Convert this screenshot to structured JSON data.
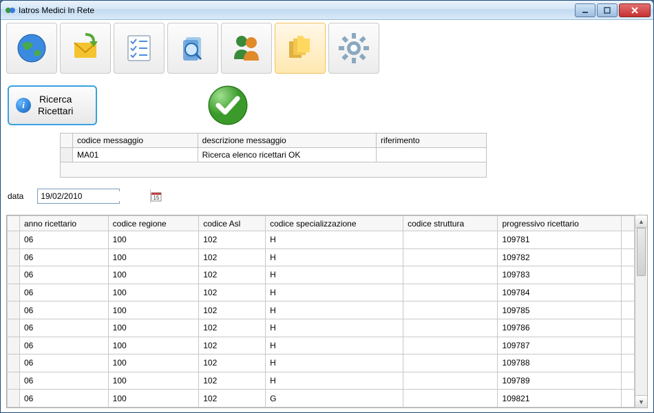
{
  "window": {
    "title": "Iatros Medici In Rete"
  },
  "toolbar": {
    "items": [
      {
        "name": "globe-icon"
      },
      {
        "name": "mail-icon"
      },
      {
        "name": "checklist-icon"
      },
      {
        "name": "search-glass-icon"
      },
      {
        "name": "people-icon"
      },
      {
        "name": "folders-icon",
        "active": true
      },
      {
        "name": "gear-icon"
      }
    ]
  },
  "ricerca": {
    "button_line1": "Ricerca",
    "button_line2": "Ricettari"
  },
  "message_table": {
    "headers": [
      "codice messaggio",
      "descrizione messaggio",
      "riferimento"
    ],
    "rows": [
      {
        "codice": "MA01",
        "descrizione": "Ricerca elenco ricettari OK",
        "riferimento": ""
      }
    ]
  },
  "data_field": {
    "label": "data",
    "value": "19/02/2010"
  },
  "results": {
    "headers": [
      "anno ricettario",
      "codice regione",
      "codice Asl",
      "codice specializzazione",
      "codice struttura",
      "progressivo ricettario"
    ],
    "rows": [
      {
        "anno": "06",
        "regione": "100",
        "asl": "102",
        "spec": "H",
        "strutt": "",
        "prog": "109781"
      },
      {
        "anno": "06",
        "regione": "100",
        "asl": "102",
        "spec": "H",
        "strutt": "",
        "prog": "109782"
      },
      {
        "anno": "06",
        "regione": "100",
        "asl": "102",
        "spec": "H",
        "strutt": "",
        "prog": "109783"
      },
      {
        "anno": "06",
        "regione": "100",
        "asl": "102",
        "spec": "H",
        "strutt": "",
        "prog": "109784"
      },
      {
        "anno": "06",
        "regione": "100",
        "asl": "102",
        "spec": "H",
        "strutt": "",
        "prog": "109785"
      },
      {
        "anno": "06",
        "regione": "100",
        "asl": "102",
        "spec": "H",
        "strutt": "",
        "prog": "109786"
      },
      {
        "anno": "06",
        "regione": "100",
        "asl": "102",
        "spec": "H",
        "strutt": "",
        "prog": "109787"
      },
      {
        "anno": "06",
        "regione": "100",
        "asl": "102",
        "spec": "H",
        "strutt": "",
        "prog": "109788"
      },
      {
        "anno": "06",
        "regione": "100",
        "asl": "102",
        "spec": "H",
        "strutt": "",
        "prog": "109789"
      },
      {
        "anno": "06",
        "regione": "100",
        "asl": "102",
        "spec": "G",
        "strutt": "",
        "prog": "109821"
      }
    ]
  }
}
